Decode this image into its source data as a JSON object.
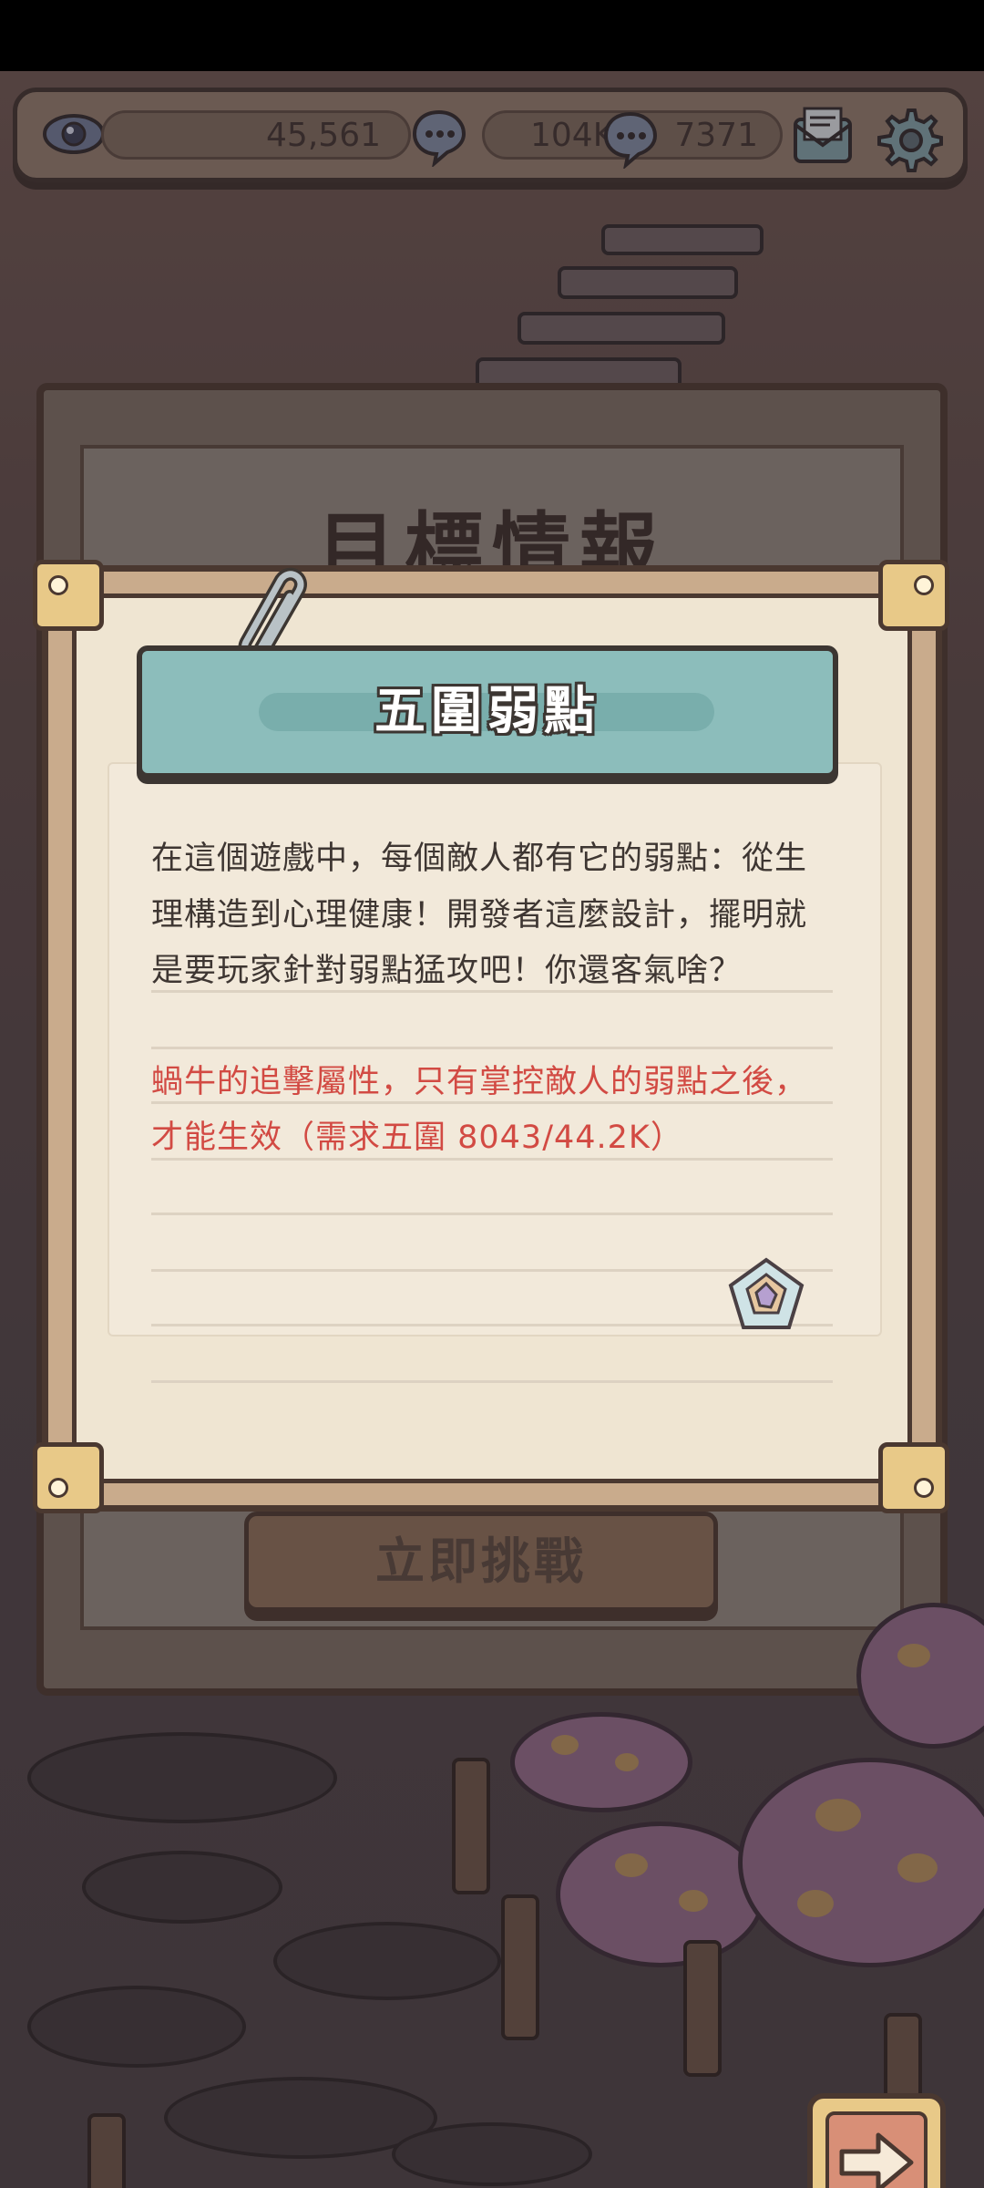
{
  "hud": {
    "views": "45,561",
    "messages_a": "104K",
    "messages_b": "7371",
    "icons": [
      "eye-icon",
      "chat-bubble-icon",
      "chat-bubble-icon",
      "mail-icon",
      "gear-icon"
    ]
  },
  "background_panel": {
    "title": "目標情報",
    "button_label": "立即挑戰"
  },
  "dialog": {
    "title": "五圍弱點",
    "body_lines": [
      "在這個遊戲中，每個敵人都有它的弱點：從生",
      "理構造到心理健康！開發者這麼設計，擺明就",
      "是要玩家針對弱點猛攻吧！你還客氣啥？"
    ],
    "note_lines": [
      "蝸牛的追擊屬性，只有掌控敵人的弱點之後，",
      "才能生效（需求五圍  8043/44.2K）"
    ],
    "note_color": "#d24a43"
  },
  "colors": {
    "banner": "#8cbdbb",
    "paper": "#efe5d2",
    "frame": "#c9ab8c"
  }
}
